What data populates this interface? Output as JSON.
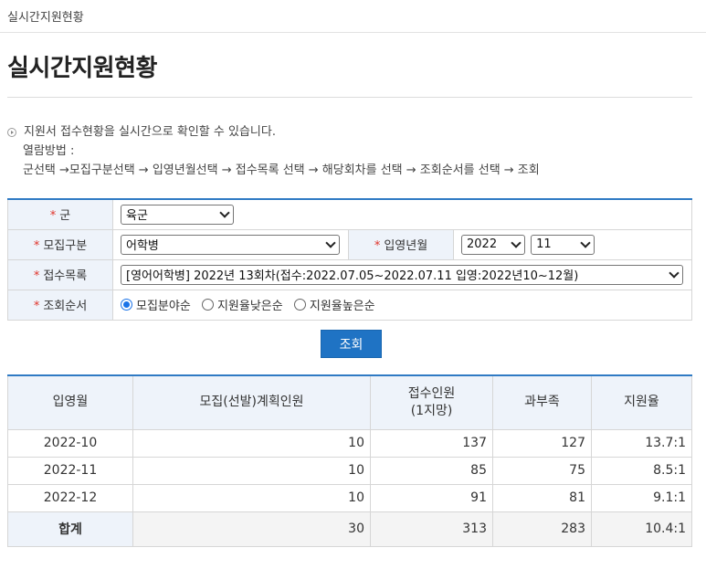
{
  "breadcrumb": "실시간지원현황",
  "page_title": "실시간지원현황",
  "info": {
    "line1": "지원서 접수현황을 실시간으로 확인할 수 있습니다.",
    "line2": "열람방법 :",
    "line3": "군선택 →모집구분선택 → 입영년월선택 → 접수목록 선택 → 해당회차를 선택 → 조회순서를 선택 → 조회"
  },
  "form": {
    "required_mark": "*",
    "branch_label": "군",
    "branch_value": "육군",
    "recruit_label": "모집구분",
    "recruit_value": "어학병",
    "enlist_label": "입영년월",
    "enlist_year": "2022",
    "enlist_month": "11",
    "receipt_label": "접수목록",
    "receipt_value": "[영어어학병] 2022년 13회차(접수:2022.07.05~2022.07.11 입영:2022년10~12월)",
    "order_label": "조회순서",
    "order_options": [
      "모집분야순",
      "지원율낮은순",
      "지원율높은순"
    ],
    "order_selected": 0
  },
  "search_button": "조회",
  "result": {
    "headers": [
      "입영월",
      "모집(선발)계획인원",
      "접수인원",
      "(1지망)",
      "과부족",
      "지원율"
    ],
    "rows": [
      [
        "2022-10",
        "10",
        "137",
        "127",
        "13.7:1"
      ],
      [
        "2022-11",
        "10",
        "85",
        "75",
        "8.5:1"
      ],
      [
        "2022-12",
        "10",
        "91",
        "81",
        "9.1:1"
      ]
    ],
    "total": [
      "합계",
      "30",
      "313",
      "283",
      "10.4:1"
    ]
  }
}
